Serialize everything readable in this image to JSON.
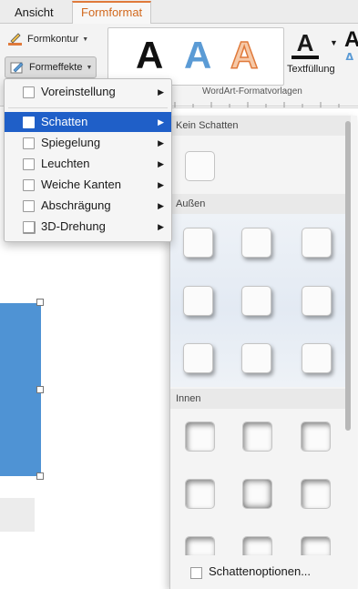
{
  "tabs": [
    {
      "label": "Ansicht",
      "active": false
    },
    {
      "label": "Formformat",
      "active": true
    }
  ],
  "ribbon": {
    "formkontur": "Formkontur",
    "formeffekte": "Formeffekte",
    "wordart_gallery_label": "WordArt-Formatvorlagen",
    "wordart_sample": "A",
    "textfill_label": "Textfüllung",
    "textfill_glyph": "A",
    "colors": {
      "accent": "#e07a3b",
      "blue": "#5b9bd5"
    }
  },
  "menu": {
    "items": [
      {
        "label": "Voreinstellung"
      },
      {
        "label": "Schatten",
        "selected": true
      },
      {
        "label": "Spiegelung"
      },
      {
        "label": "Leuchten"
      },
      {
        "label": "Weiche Kanten"
      },
      {
        "label": "Abschrägung"
      },
      {
        "label": "3D-Drehung"
      }
    ],
    "submenu_arrow": "▶"
  },
  "shadow_panel": {
    "sections": {
      "none": "Kein Schatten",
      "outer": "Außen",
      "inner": "Innen"
    },
    "options_label": "Schattenoptionen..."
  }
}
